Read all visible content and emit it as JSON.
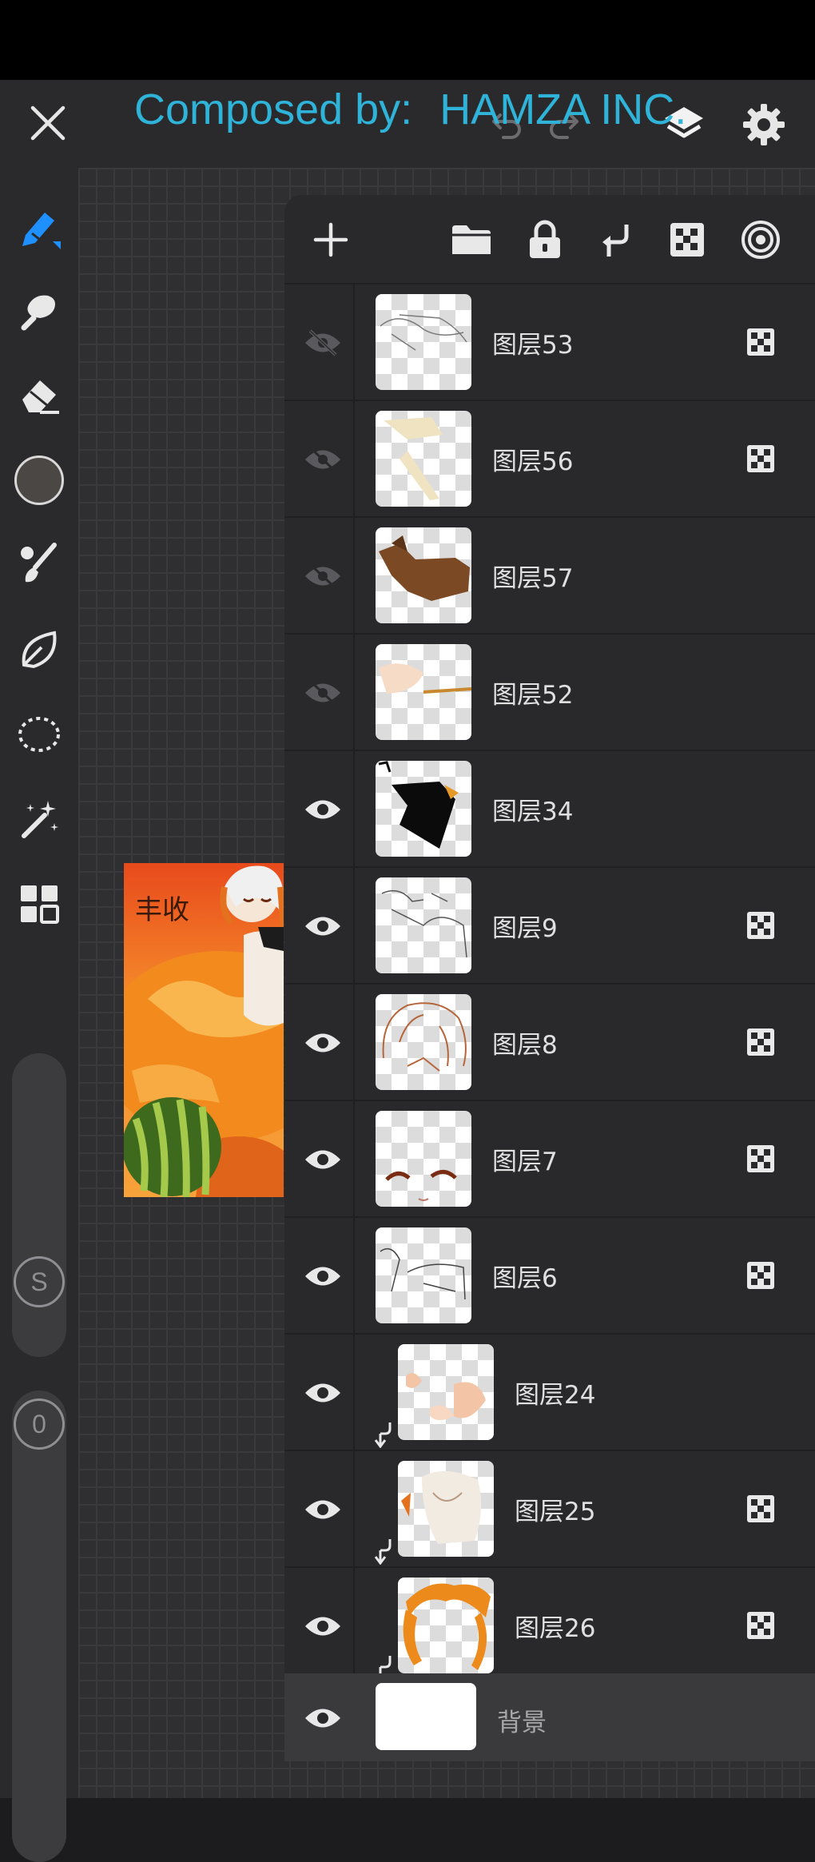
{
  "watermark": {
    "prefix": "Composed by:",
    "name": "HAMZA INC."
  },
  "layers": [
    {
      "name": "图层53",
      "visible": false,
      "blend_icon": true
    },
    {
      "name": "图层56",
      "visible": false,
      "blend_icon": true
    },
    {
      "name": "图层57",
      "visible": false,
      "blend_icon": false
    },
    {
      "name": "图层52",
      "visible": false,
      "blend_icon": false
    },
    {
      "name": "图层34",
      "visible": true,
      "blend_icon": false
    },
    {
      "name": "图层9",
      "visible": true,
      "blend_icon": true
    },
    {
      "name": "图层8",
      "visible": true,
      "blend_icon": true
    },
    {
      "name": "图层7",
      "visible": true,
      "blend_icon": true
    },
    {
      "name": "图层6",
      "visible": true,
      "blend_icon": true
    },
    {
      "name": "图层24",
      "visible": true,
      "blend_icon": false,
      "clipped": true
    },
    {
      "name": "图层25",
      "visible": true,
      "blend_icon": true,
      "clipped": true
    },
    {
      "name": "图层26",
      "visible": true,
      "blend_icon": true,
      "clipped": true
    }
  ],
  "background_layer": {
    "name": "背景",
    "visible": true
  },
  "sliders": {
    "size_label": "S",
    "opacity_label": "0"
  },
  "colors": {
    "accent": "#1e90ff",
    "watermark": "#2fb3d9",
    "current_color": "#4a4745"
  },
  "artwork_text": "丰收"
}
